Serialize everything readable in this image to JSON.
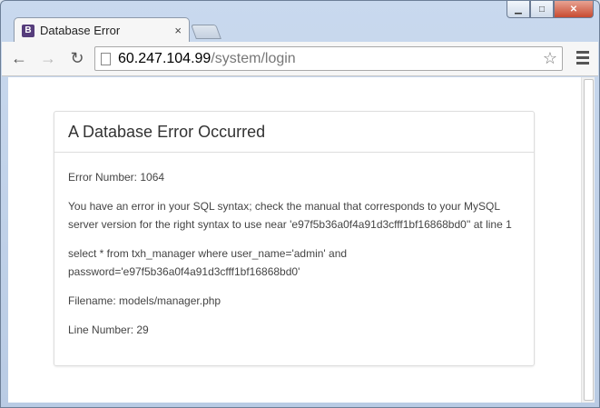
{
  "browser": {
    "tab": {
      "title": "Database Error",
      "favicon_letter": "B",
      "close_glyph": "×"
    },
    "caption": {
      "minimize": "▁",
      "maximize": "□",
      "close": "✕"
    },
    "nav": {
      "back": "←",
      "forward": "→",
      "reload": "↻"
    },
    "address": {
      "host": "60.247.104.99",
      "path": "/system/login"
    }
  },
  "error": {
    "heading": "A Database Error Occurred",
    "error_number": "Error Number: 1064",
    "message": "You have an error in your SQL syntax; check the manual that corresponds to your MySQL server version for the right syntax to use near 'e97f5b36a0f4a91d3cfff1bf16868bd0'' at line 1",
    "query": "select * from txh_manager where user_name='admin' and password='e97f5b36a0f4a91d3cfff1bf16868bd0'",
    "filename": "Filename: models/manager.php",
    "line_number": "Line Number: 29"
  },
  "colors": {
    "favicon": "#563d7c",
    "close_button": "#c84b31"
  }
}
